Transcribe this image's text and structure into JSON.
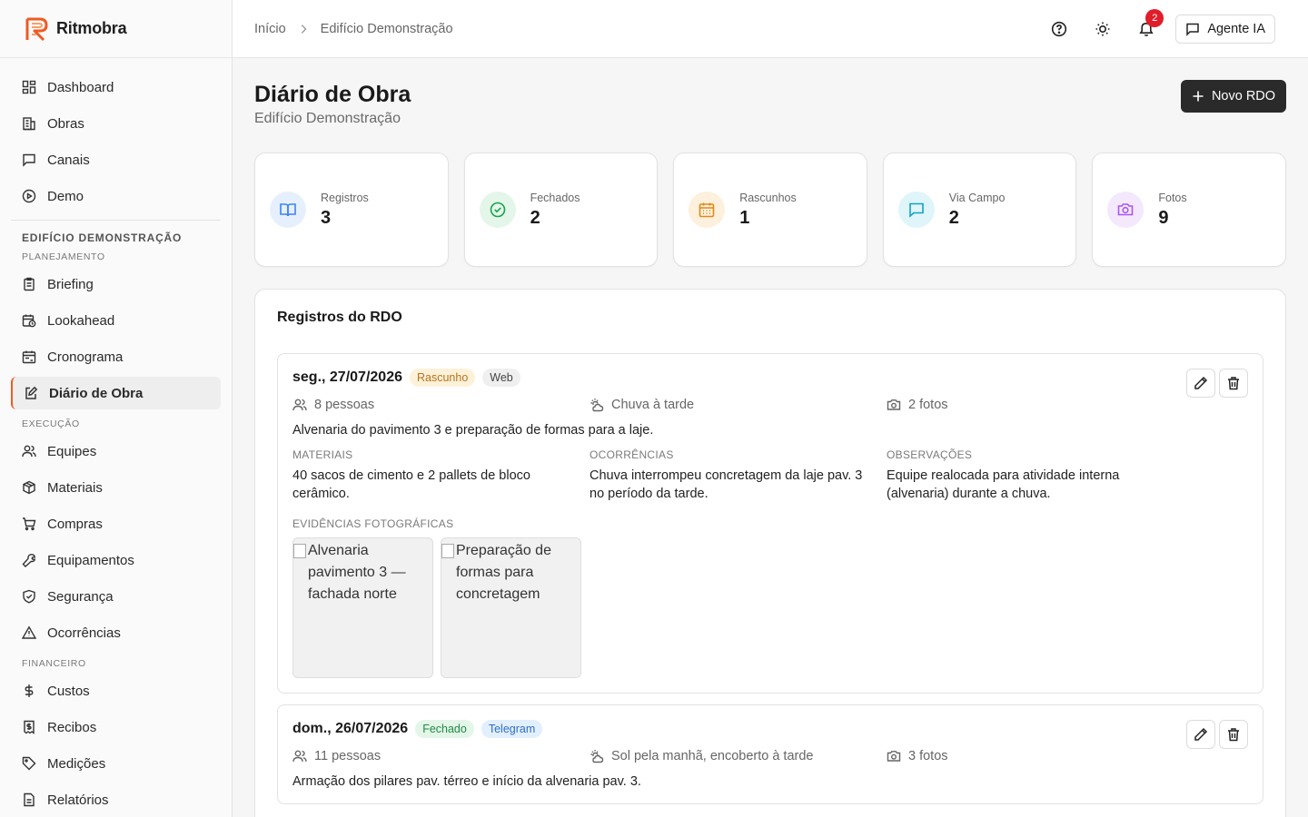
{
  "app": {
    "name": "Ritmobra"
  },
  "colors": {
    "accent": "#f05a22",
    "badge": "#e11d2a",
    "primary_button": "#2a2a2a"
  },
  "sidebar": {
    "top_items": [
      {
        "label": "Dashboard",
        "icon": "dashboard-icon"
      },
      {
        "label": "Obras",
        "icon": "building-icon"
      },
      {
        "label": "Canais",
        "icon": "message-square-icon"
      },
      {
        "label": "Demo",
        "icon": "play-circle-icon"
      }
    ],
    "project_title": "EDIFÍCIO DEMONSTRAÇÃO",
    "groups": [
      {
        "title": "PLANEJAMENTO",
        "items": [
          {
            "label": "Briefing",
            "icon": "clipboard-icon"
          },
          {
            "label": "Lookahead",
            "icon": "calendar-clock-icon"
          },
          {
            "label": "Cronograma",
            "icon": "calendar-range-icon"
          },
          {
            "label": "Diário de Obra",
            "icon": "edit-note-icon",
            "active": true
          }
        ]
      },
      {
        "title": "EXECUÇÃO",
        "items": [
          {
            "label": "Equipes",
            "icon": "users-icon"
          },
          {
            "label": "Materiais",
            "icon": "package-icon"
          },
          {
            "label": "Compras",
            "icon": "cart-icon"
          },
          {
            "label": "Equipamentos",
            "icon": "wrench-icon"
          },
          {
            "label": "Segurança",
            "icon": "shield-icon"
          },
          {
            "label": "Ocorrências",
            "icon": "alert-triangle-icon"
          }
        ]
      },
      {
        "title": "FINANCEIRO",
        "items": [
          {
            "label": "Custos",
            "icon": "dollar-icon"
          },
          {
            "label": "Recibos",
            "icon": "receipt-icon"
          },
          {
            "label": "Medições",
            "icon": "tag-icon"
          },
          {
            "label": "Relatórios",
            "icon": "file-icon"
          }
        ]
      }
    ]
  },
  "header": {
    "breadcrumb": [
      "Início",
      "Edifício Demonstração"
    ],
    "notifications_count": "2",
    "agent_label": "Agente IA"
  },
  "page": {
    "title": "Diário de Obra",
    "subtitle": "Edifício Demonstração",
    "new_button": "Novo RDO"
  },
  "stats": [
    {
      "label": "Registros",
      "value": "3",
      "icon": "book-open-icon",
      "color": "#3b82f6",
      "bg": "#e6f0fd"
    },
    {
      "label": "Fechados",
      "value": "2",
      "icon": "check-circle-icon",
      "color": "#16a34a",
      "bg": "#e4f6ea"
    },
    {
      "label": "Rascunhos",
      "value": "1",
      "icon": "calendar-icon",
      "color": "#e0891a",
      "bg": "#fdf0dc"
    },
    {
      "label": "Via Campo",
      "value": "2",
      "icon": "message-square-icon",
      "color": "#0ea5c6",
      "bg": "#dff5fa"
    },
    {
      "label": "Fotos",
      "value": "9",
      "icon": "camera-icon",
      "color": "#a855f7",
      "bg": "#f4e8fd"
    }
  ],
  "records_panel": {
    "title": "Registros do RDO",
    "labels": {
      "materials": "MATERIAIS",
      "occurrences": "OCORRÊNCIAS",
      "observations": "OBSERVAÇÕES",
      "photos": "EVIDÊNCIAS FOTOGRÁFICAS"
    },
    "records": [
      {
        "date": "seg., 27/07/2026",
        "status": "Rascunho",
        "channel": "Web",
        "people": "8 pessoas",
        "weather": "Chuva à tarde",
        "photos_count": "2 fotos",
        "description": "Alvenaria do pavimento 3 e preparação de formas para a laje.",
        "materials": "40 sacos de cimento e 2 pallets de bloco cerâmico.",
        "occurrences": "Chuva interrompeu concretagem da laje pav. 3 no período da tarde.",
        "observations": "Equipe realocada para atividade interna (alvenaria) durante a chuva.",
        "photos": [
          "Alvenaria pavimento 3 — fachada norte",
          "Preparação de formas para concretagem"
        ]
      },
      {
        "date": "dom., 26/07/2026",
        "status": "Fechado",
        "channel": "Telegram",
        "people": "11 pessoas",
        "weather": "Sol pela manhã, encoberto à tarde",
        "photos_count": "3 fotos",
        "description": "Armação dos pilares pav. térreo e início da alvenaria pav. 3."
      }
    ]
  }
}
